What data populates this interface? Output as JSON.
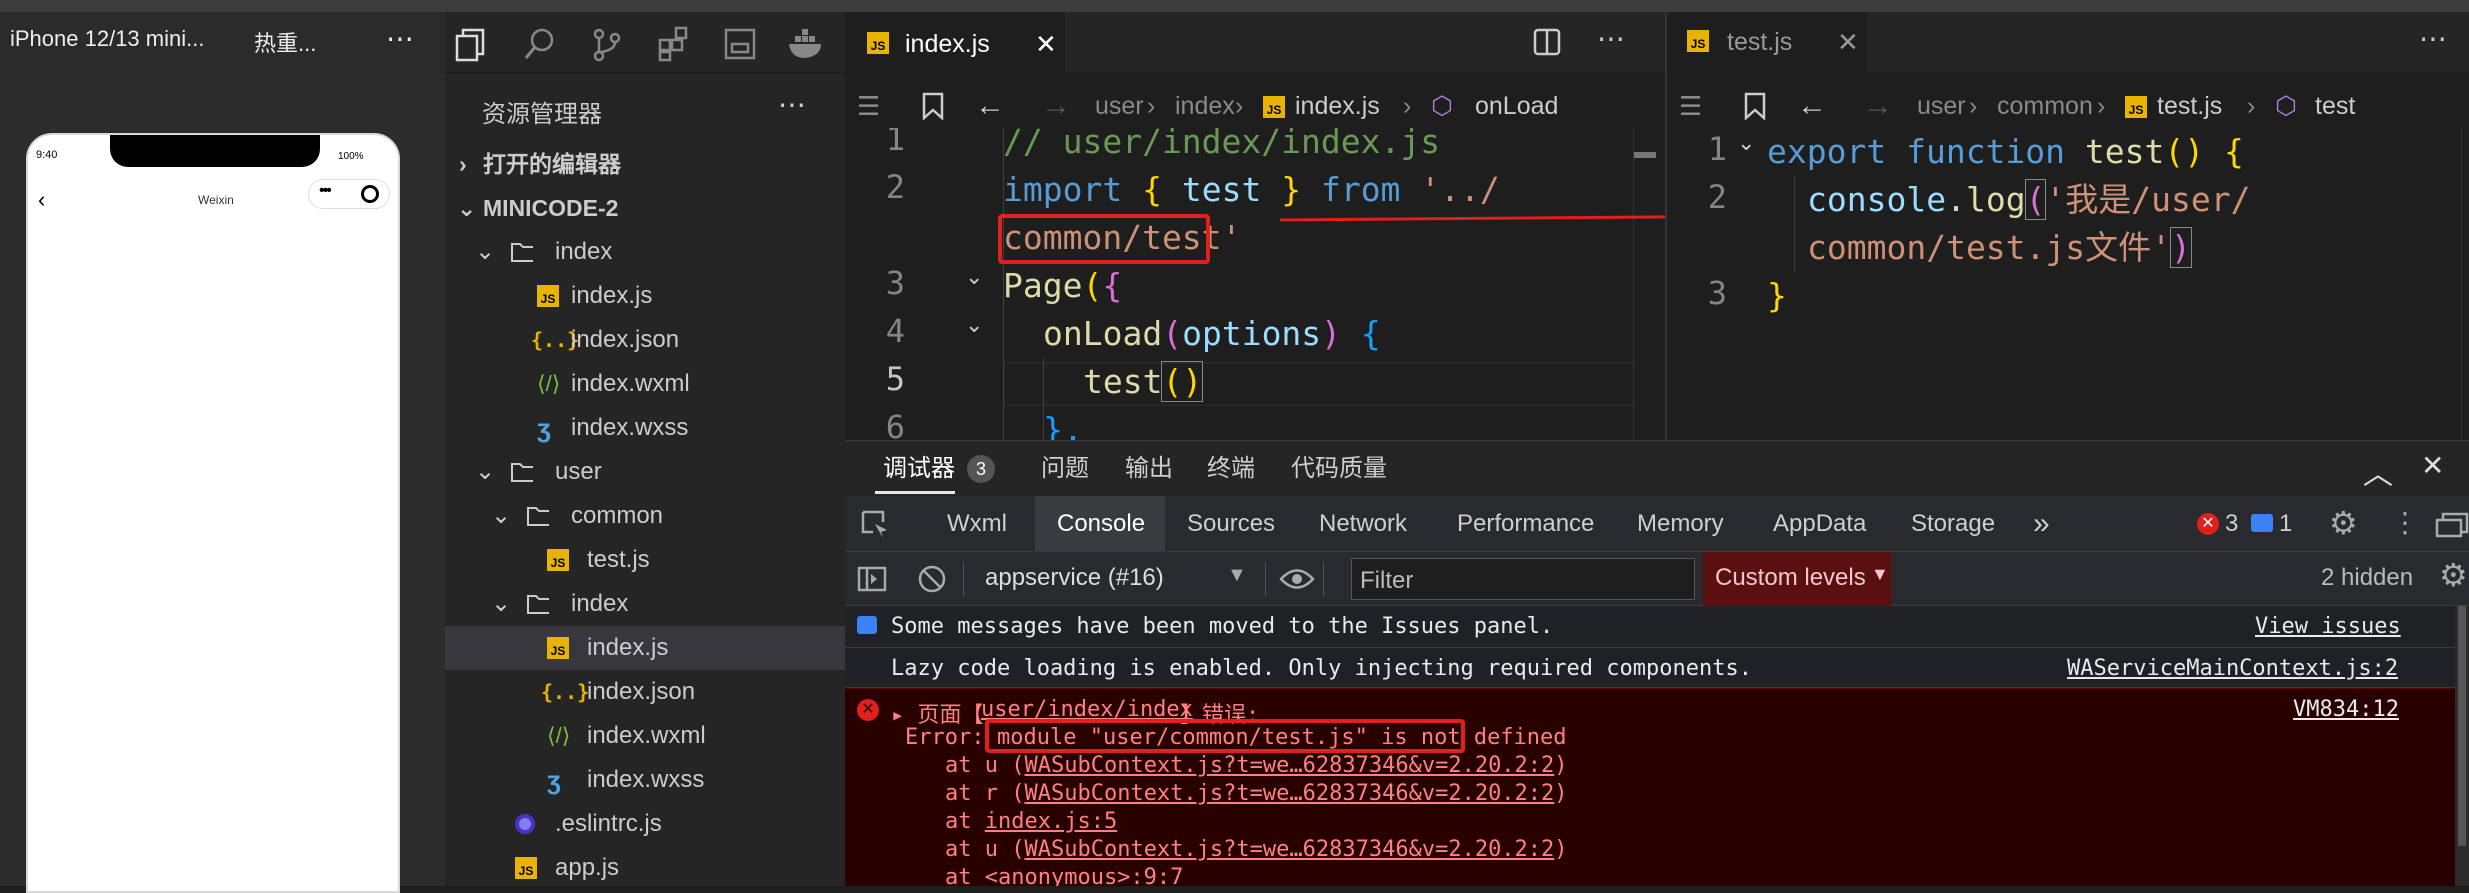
{
  "simulator": {
    "device": "iPhone 12/13 mini...",
    "hot": "热重...",
    "more": "⋯",
    "time": "9:40",
    "battery": "100%",
    "nav_title": "Weixin"
  },
  "explorer": {
    "title": "资源管理器",
    "more": "⋯",
    "open_editors": "打开的编辑器",
    "project": "MINICODE-2",
    "items": [
      {
        "label": "index",
        "type": "folder"
      },
      {
        "label": "index.js",
        "type": "js"
      },
      {
        "label": "index.json",
        "type": "json"
      },
      {
        "label": "index.wxml",
        "type": "wxml"
      },
      {
        "label": "index.wxss",
        "type": "css"
      },
      {
        "label": "user",
        "type": "folder"
      },
      {
        "label": "common",
        "type": "folder"
      },
      {
        "label": "test.js",
        "type": "js"
      },
      {
        "label": "index",
        "type": "folder"
      },
      {
        "label": "index.js",
        "type": "js"
      },
      {
        "label": "index.json",
        "type": "json"
      },
      {
        "label": "index.wxml",
        "type": "wxml"
      },
      {
        "label": "index.wxss",
        "type": "css"
      },
      {
        "label": ".eslintrc.js",
        "type": "eslint"
      },
      {
        "label": "app.js",
        "type": "js"
      }
    ]
  },
  "editor1": {
    "tab": "index.js",
    "crumbs": [
      "user",
      "index",
      "index.js",
      "onLoad"
    ],
    "line_numbers": [
      "1",
      "2",
      "3",
      "4",
      "5",
      "6"
    ],
    "code": {
      "l1": "// user/index/index.js",
      "l2a": "import",
      "l2b": "{",
      "l2c": "test",
      "l2d": "}",
      "l2e": "from",
      "l2f": "'../",
      "l2g": "common/test'",
      "l3a": "Page",
      "l3b": "(",
      "l3c": "{",
      "l4a": "onLoad",
      "l4b": "(",
      "l4c": "options",
      "l4d": ")",
      "l4e": "{",
      "l5a": "test",
      "l5b": "()",
      "l6": "},"
    }
  },
  "editor2": {
    "tab": "test.js",
    "crumbs": [
      "user",
      "common",
      "test.js",
      "test"
    ],
    "line_numbers": [
      "1",
      "2",
      "3"
    ],
    "code": {
      "l1a": "export",
      "l1b": "function",
      "l1c": "test",
      "l1d": "()",
      "l1e": "{",
      "l2a": "console",
      "l2b": ".",
      "l2c": "log",
      "l2d": "(",
      "l2e": "'我是/user/",
      "l2f": "common/test.js文件'",
      "l2g": ")",
      "l3": "}"
    }
  },
  "devtools": {
    "tabs": {
      "debugger": "调试器",
      "count": "3",
      "problems": "问题",
      "output": "输出",
      "terminal": "终端",
      "quality": "代码质量"
    },
    "panels": [
      "Wxml",
      "Console",
      "Sources",
      "Network",
      "Performance",
      "Memory",
      "AppData",
      "Storage"
    ],
    "overflow": "»",
    "error_count": "3",
    "msg_count": "1",
    "context": "appservice (#16)",
    "filter_placeholder": "Filter",
    "levels": "Custom levels",
    "hidden": "2 hidden",
    "messages": {
      "moved": "Some messages have been moved to the Issues panel.",
      "view_issues": "View issues",
      "lazy": "Lazy code loading is enabled. Only injecting required components.",
      "lazy_src": "WAServiceMainContext.js:2",
      "err_prefix": "▸ 页面【",
      "err_path": "user/index/index",
      "err_suffix": "】错误:",
      "err_src": "VM834:12",
      "error_label": "Error:",
      "error_msg": "module \"user/common/test.js\" is not defined",
      "stack": [
        {
          "at": "at u (",
          "link": "WASubContext.js?t=we…62837346&v=2.20.2:2",
          "end": ")"
        },
        {
          "at": "at r (",
          "link": "WASubContext.js?t=we…62837346&v=2.20.2:2",
          "end": ")"
        },
        {
          "at": "at ",
          "link": "index.js:5",
          "end": ""
        },
        {
          "at": "at u (",
          "link": "WASubContext.js?t=we…62837346&v=2.20.2:2",
          "end": ")"
        },
        {
          "at": "at <anonymous>:9:7",
          "link": "",
          "end": ""
        }
      ]
    }
  },
  "colors": {
    "error_bg": "#290000",
    "error_text": "#ff8080",
    "annotation": "#e0201a",
    "accent": "#e8b400"
  }
}
